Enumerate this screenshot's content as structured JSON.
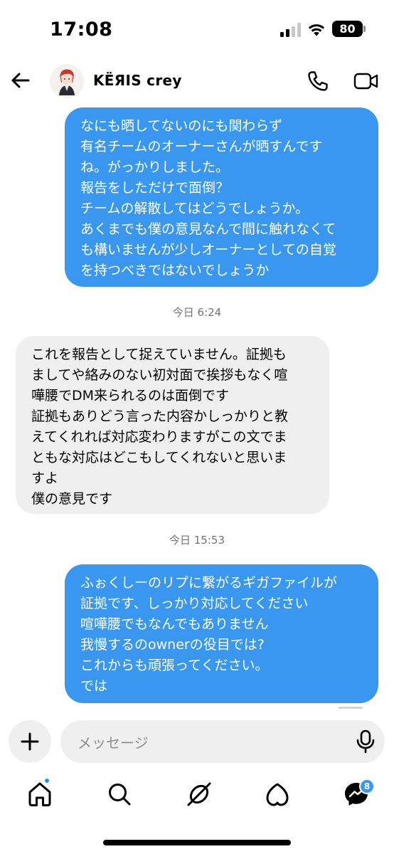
{
  "status_bar": {
    "time": "17:08",
    "battery": "80"
  },
  "header": {
    "contact_name": "KËЯIS crey",
    "icons": [
      "back-arrow-icon",
      "phone-icon",
      "video-camera-icon"
    ]
  },
  "messages": [
    {
      "direction": "sent",
      "lines": [
        "なにも晒してないのにも関わらず",
        "有名チームのオーナーさんが晒すんです",
        "ね。がっかりしました。",
        "報告をしただけで面倒？",
        "チームの解散してはどうでしょうか。",
        "あくまでも僕の意見なんで間に触れなくて",
        "も構いませんが少しオーナーとしての自覚",
        "を持つべきではないでしょうか"
      ]
    },
    {
      "direction": "received",
      "timestamp": "今日 6:24",
      "lines": [
        "これを報告として捉えていません。証拠も",
        "ましてや絡みのない初対面で挨拶もなく喧",
        "嘩腰でDM来られるのは面倒です",
        "証拠もありどう言った内容かしっかりと教",
        "えてくれれば対応変わりますがこの文でま",
        "ともな対応はどこもしてくれないと思いま",
        "すよ",
        "僕の意見です"
      ]
    },
    {
      "direction": "sent",
      "timestamp": "今日 15:53",
      "lines": [
        "ふぉくしーのリプに繋がるギガファイルが",
        "証拠です、しっかり対応してください",
        "喧嘩腰でもなんでもありません",
        "我慢するのownerの役目では?",
        "これからも頑張ってください。",
        "では"
      ]
    }
  ],
  "composer": {
    "placeholder": "メッセージ"
  },
  "nav": {
    "items": [
      "home-icon",
      "search-icon",
      "explore-icon",
      "heart-icon",
      "messenger-icon"
    ],
    "messages_badge": "8"
  },
  "colors": {
    "sent_bubble": "#3a97ef",
    "received_bubble": "#efefef"
  }
}
